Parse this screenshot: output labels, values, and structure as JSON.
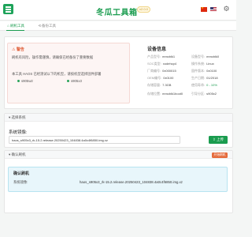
{
  "header": {
    "title": "冬瓜工具箱",
    "version": "v2.0.0",
    "icons": [
      "logo-icon",
      "flag-cn-icon",
      "flag-us-icon",
      "settings-icon"
    ]
  },
  "tabs": [
    {
      "label": "刷机工具",
      "icon": "home-icon",
      "active": true
    },
    {
      "label": "备份工具",
      "icon": "backup-icon",
      "active": false
    }
  ],
  "notice": {
    "title": "警告",
    "lines": [
      "刷机有风险，操作需谨慎，请确保已经备份了重要数据"
    ],
    "supported_line": "本工具 HAOS 已经测试以下的机型，请按机型选择固件部署",
    "models": [
      "s905w2",
      "s905x3",
      "s905d",
      "s905x2"
    ]
  },
  "device": {
    "title": "设备信息",
    "left": [
      {
        "k": "产品型号:",
        "v": "mmcblk1"
      },
      {
        "k": "SOC类型:",
        "v": "xodehcp4"
      },
      {
        "k": "厂商编号:",
        "v": "0x000015"
      },
      {
        "k": "OEM编号:",
        "v": "0x0100"
      },
      {
        "k": "存储容量:",
        "v": "7.3GB"
      },
      {
        "k": "存储位置:",
        "v": "mmcblk1boot0"
      }
    ],
    "right": [
      {
        "k": "设备型号:",
        "v": "mmcblk0"
      },
      {
        "k": "操作系统:",
        "v": "Linux"
      },
      {
        "k": "固件版本:",
        "v": "0x0100"
      },
      {
        "k": "生产日期:",
        "v": "01/2018"
      },
      {
        "k": "使用寿命:",
        "v": "0 - 10%"
      },
      {
        "k": "引导分区:",
        "v": "s905x2"
      }
    ]
  },
  "firmware": {
    "section": "选择系统",
    "label": "系统镜像:",
    "value": "haos_s905x3_rk-15.2.release.20250423_104838.4a0c4f6850.img.xz",
    "upload": "上传"
  },
  "confirm": {
    "section": "确认刷机",
    "flash": "开始刷机",
    "title": "确认刷机",
    "label": "系统镜像:",
    "value": "haos_s905x3_rk-15.2.release.20250423_104838.4a0c4f6850.img.xz"
  }
}
